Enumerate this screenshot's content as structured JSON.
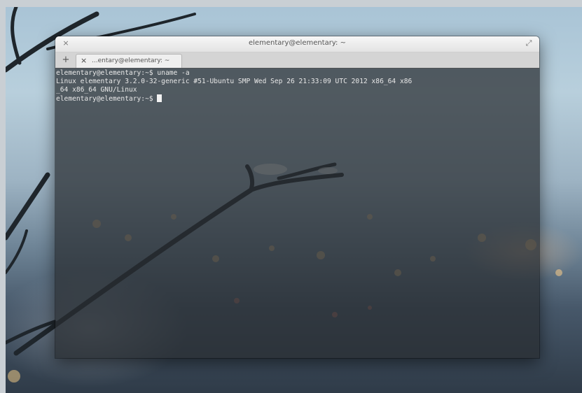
{
  "window": {
    "title": "elementary@elementary: ~",
    "close_glyph": "×",
    "maximize_glyph": "⤢"
  },
  "tabs": {
    "new_tab_glyph": "+",
    "items": [
      {
        "close_glyph": "×",
        "label": "...entary@elementary: ~"
      }
    ]
  },
  "terminal": {
    "lines": [
      "elementary@elementary:~$ uname -a",
      "Linux elementary 3.2.0-32-generic #51-Ubuntu SMP Wed Sep 26 21:33:09 UTC 2012 x86_64 x86",
      "_64 x86_64 GNU/Linux"
    ],
    "prompt": "elementary@elementary:~$ "
  },
  "colors": {
    "terminal_bg": "#282c30",
    "terminal_fg": "#e8e8e8",
    "titlebar": "#ececec"
  }
}
